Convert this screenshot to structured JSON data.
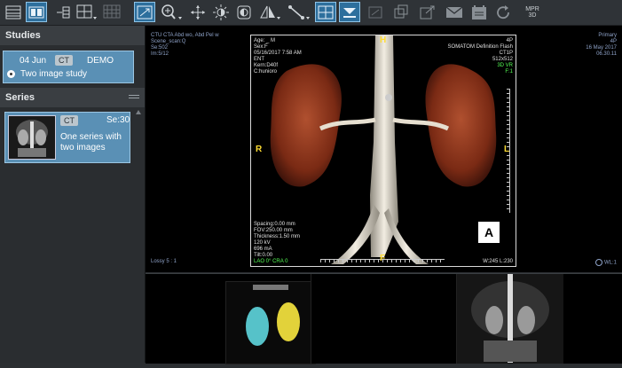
{
  "toolbar": {
    "icons": [
      "studies-list-icon",
      "layout-icon",
      "series-layout-icon",
      "grid-icon",
      "grid-disabled-icon",
      "fit-icon",
      "zoom-icon",
      "pan-icon",
      "window-level-icon",
      "invert-icon",
      "flip-icon",
      "measure-icon",
      "crosshair-icon",
      "reference-lines-icon",
      "cine-icon",
      "overlay-icon",
      "share-icon",
      "mail-icon",
      "report-icon",
      "rotate-icon",
      "mpr-3d-icon"
    ],
    "mpr_label": "MPR\n3D"
  },
  "sidebar": {
    "studies_title": "Studies",
    "study": {
      "date": "04 Jun",
      "modality": "CT",
      "patient": "DEMO",
      "description": "Two image study"
    },
    "series_title": "Series",
    "series": {
      "modality": "CT",
      "number": "Se:30",
      "description_line1": "One series with",
      "description_line2": "two images"
    }
  },
  "viewer": {
    "top_left": [
      "CTU CTA Abd wo, Abd Pel w",
      "Scene_scan:Q",
      "Se:502",
      "Im:5/12"
    ],
    "top_right": [
      "Primary",
      "4P",
      "16 May 2017",
      "06.30.11"
    ],
    "inner_tl": [
      "Age: _ M",
      "Sex:F",
      "05/16/2017 7:58 AM",
      "ENT",
      "Kern:D40f",
      "C:hunioro"
    ],
    "inner_tr": [
      "4P",
      "SOMATOM Definition Flash",
      "CT1P",
      "512x512",
      "3D VR",
      "F:1"
    ],
    "inner_bl": [
      "Spacing:0.00 mm",
      "FOV:250.00 mm",
      "Thickness:1.50 mm",
      "120 kV",
      "696 mA",
      "Tilt:0.00",
      "LAO 0° CRA 0"
    ],
    "inner_br": [
      "W:245 L:230"
    ],
    "bottom_left": "Lossy 5 : 1",
    "bottom_right": "WL:1",
    "orient_top": "H",
    "orient_left": "R",
    "orient_right": "L",
    "orient_bottom": "F",
    "orient_cube": "A"
  }
}
